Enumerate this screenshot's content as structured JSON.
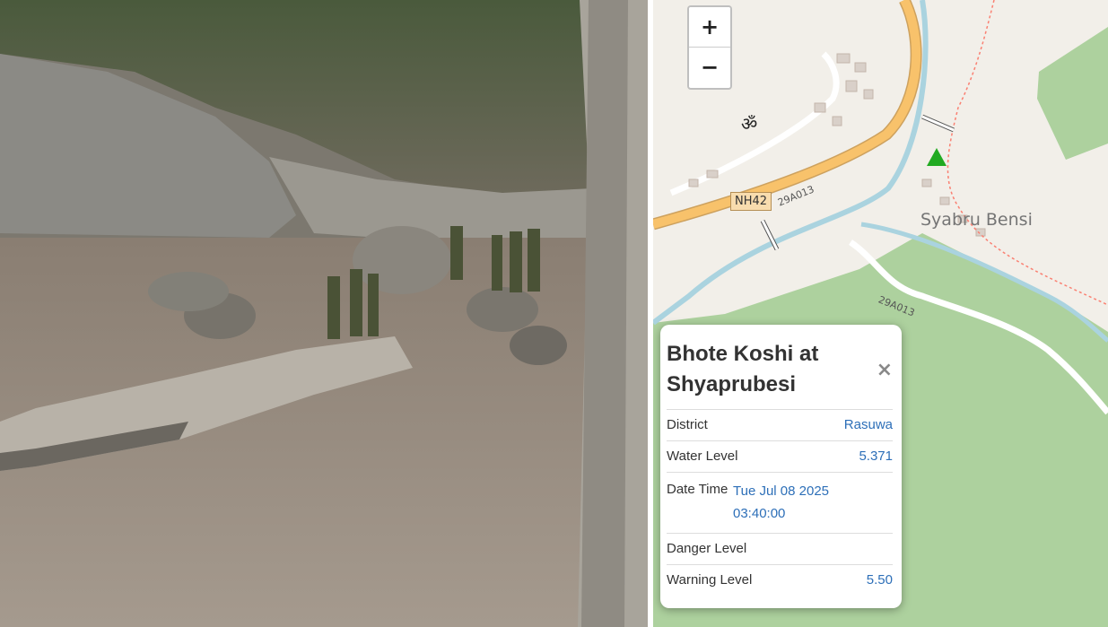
{
  "map": {
    "zoom_in_label": "+",
    "zoom_out_label": "−",
    "town_label": "Syabru Bensi",
    "road_shield": "NH42",
    "road_ref_1": "29A013",
    "road_ref_2": "29A013",
    "place_of_worship_symbol": "ॐ",
    "station_marker_icon": "triangle-icon",
    "colors": {
      "land": "#f2efe9",
      "forest": "#add19e",
      "highway": "#f8c26b",
      "river": "#aad3df"
    }
  },
  "popup": {
    "title": "Bhote Koshi at Shyaprubesi",
    "close_label": "×",
    "rows": [
      {
        "label": "District",
        "value": "Rasuwa"
      },
      {
        "label": "Water Level",
        "value": "5.371"
      },
      {
        "label": "Date Time",
        "value_date": "Tue Jul 08 2025",
        "value_time": "03:40:00"
      },
      {
        "label": "Danger Level",
        "value": ""
      },
      {
        "label": "Warning Level",
        "value": "5.50"
      }
    ]
  }
}
